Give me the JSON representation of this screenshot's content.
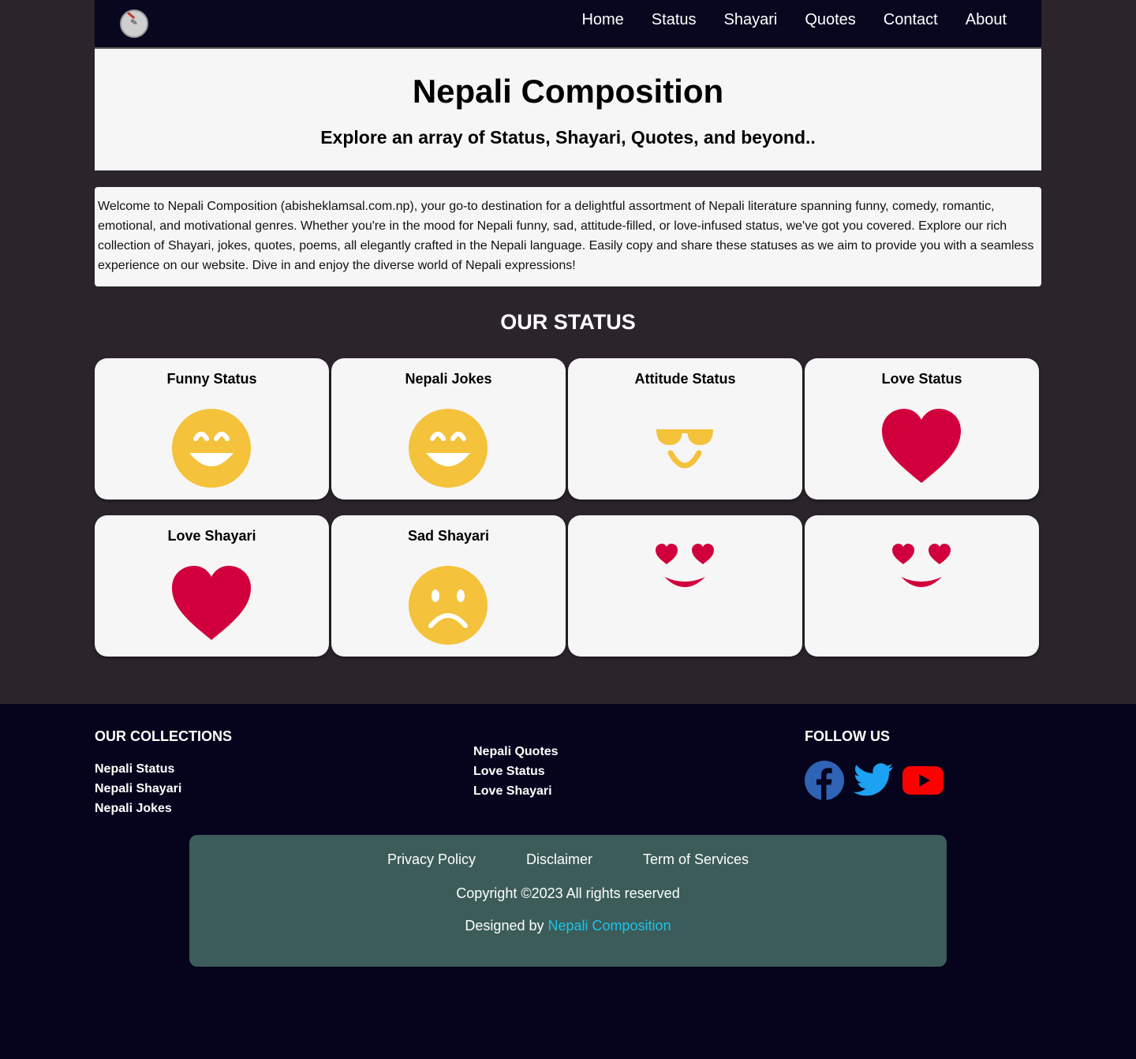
{
  "nav": {
    "links": [
      "Home",
      "Status",
      "Shayari",
      "Quotes",
      "Contact",
      "About"
    ]
  },
  "hero": {
    "title": "Nepali Composition",
    "subtitle": "Explore an array of Status, Shayari, Quotes, and beyond.."
  },
  "intro": {
    "text": "Welcome to Nepali Composition (abisheklamsal.com.np), your go-to destination for a delightful assortment of Nepali literature spanning funny, comedy, romantic, emotional, and motivational genres. Whether you're in the mood for Nepali funny, sad, attitude-filled, or love-infused status, we've got you covered. Explore our rich collection of Shayari, jokes, quotes, poems, all elegantly crafted in the Nepali language. Easily copy and share these statuses as we aim to provide you with a seamless experience on our website. Dive in and enjoy the diverse world of Nepali expressions!"
  },
  "status_section": {
    "title": "OUR STATUS",
    "cards": [
      {
        "title": "Funny Status",
        "icon": "grinning-face-icon"
      },
      {
        "title": "Nepali Jokes",
        "icon": "grinning-face-icon"
      },
      {
        "title": "Attitude Status",
        "icon": "sunglasses-smile-icon"
      },
      {
        "title": "Love Status",
        "icon": "heart-icon"
      },
      {
        "title": "Love Shayari",
        "icon": "heart-icon"
      },
      {
        "title": "Sad Shayari",
        "icon": "sad-face-icon"
      },
      {
        "title": "",
        "icon": "heart-eyes-icon"
      },
      {
        "title": "",
        "icon": "heart-eyes-icon"
      }
    ]
  },
  "footer": {
    "collections_title": "OUR COLLECTIONS",
    "col1": [
      "Nepali Status",
      "Nepali Shayari",
      "Nepali Jokes"
    ],
    "col2": [
      "Nepali Quotes",
      "Love Status",
      "Love Shayari"
    ],
    "follow_title": "FOLLOW US",
    "social": [
      "facebook-icon",
      "twitter-icon",
      "youtube-icon"
    ],
    "legal": [
      "Privacy Policy",
      "Disclaimer",
      "Term of Services"
    ],
    "copyright": "Copyright ©2023 All rights reserved",
    "designed_prefix": "Designed by ",
    "designed_brand": "Nepali Composition"
  },
  "colors": {
    "nav_bg": "#07071f",
    "page_bg": "#2b252b",
    "emoji_yellow": "#f4c23b",
    "heart_red": "#d1003c",
    "facebook_blue": "#2f63b5",
    "twitter_blue": "#1da1f2",
    "youtube_red": "#ff0000",
    "footer_box": "#3b5c59",
    "brand_link": "#1ec3ea"
  }
}
